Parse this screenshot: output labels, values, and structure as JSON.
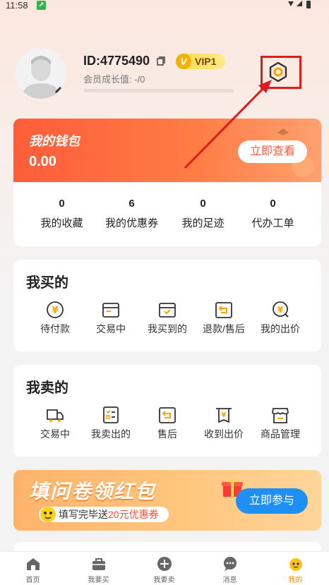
{
  "status_bar": {
    "time": "11:58"
  },
  "profile": {
    "user_id": "ID:4775490",
    "vip_level": "VIP1",
    "vip_letter": "V",
    "growth_text": "会员成长值: -/0",
    "growth_progress": 0
  },
  "wallet": {
    "title": "我的钱包",
    "amount": "0.00",
    "view_button": "立即查看",
    "stats": [
      {
        "value": "0",
        "label": "我的收藏"
      },
      {
        "value": "6",
        "label": "我的优惠券"
      },
      {
        "value": "0",
        "label": "我的足迹"
      },
      {
        "value": "0",
        "label": "代办工单"
      }
    ]
  },
  "buy_section": {
    "title": "我买的",
    "items": [
      {
        "label": "待付款",
        "icon": "yuan-coin-icon"
      },
      {
        "label": "交易中",
        "icon": "box-icon"
      },
      {
        "label": "我买到的",
        "icon": "box-check-icon"
      },
      {
        "label": "退款/售后",
        "icon": "return-icon"
      },
      {
        "label": "我的出价",
        "icon": "bid-icon"
      }
    ]
  },
  "sell_section": {
    "title": "我卖的",
    "items": [
      {
        "label": "交易中",
        "icon": "truck-icon"
      },
      {
        "label": "我卖出的",
        "icon": "list-icon"
      },
      {
        "label": "售后",
        "icon": "return-icon"
      },
      {
        "label": "收到出价",
        "icon": "receipt-icon"
      },
      {
        "label": "商品管理",
        "icon": "store-icon"
      }
    ]
  },
  "banner": {
    "title": "填问卷领红包",
    "subtitle_prefix": "填写完毕送",
    "subtitle_highlight": "20元优惠券",
    "button": "立即参与"
  },
  "tabbar": {
    "active_index": 4,
    "items": [
      {
        "label": "首页",
        "icon": "home-icon"
      },
      {
        "label": "我要买",
        "icon": "bag-icon"
      },
      {
        "label": "我要卖",
        "icon": "plus-circle-icon"
      },
      {
        "label": "消息",
        "icon": "message-icon"
      },
      {
        "label": "我的",
        "icon": "mascot-icon"
      }
    ]
  },
  "colors": {
    "accent": "#ff5c3a",
    "highlight_box": "#e01a1a",
    "tab_active": "#ff8a00",
    "banner_button": "#1d8ff5"
  }
}
